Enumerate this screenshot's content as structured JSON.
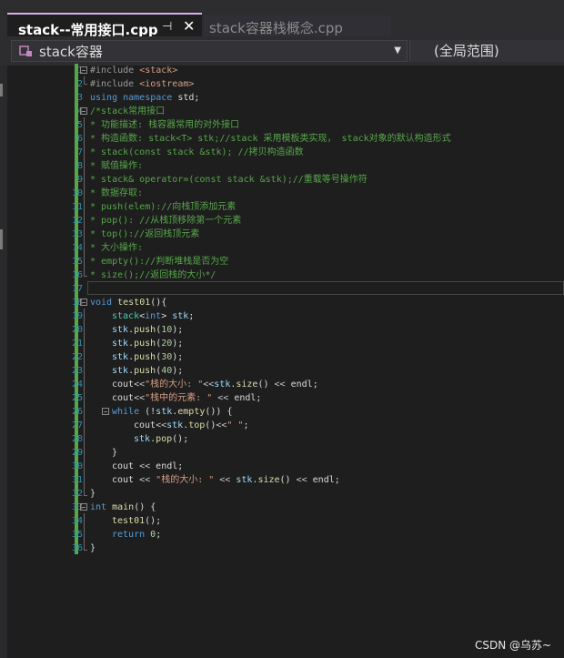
{
  "tabs": {
    "active": {
      "title": "stack--常用接口.cpp",
      "pin_glyph": "⊣",
      "close_glyph": "✕"
    },
    "inactive": {
      "title": "stack容器栈概念.cpp"
    }
  },
  "nav": {
    "scope_value": "stack容器",
    "global_scope": "(全局范围)"
  },
  "editor": {
    "line_numbers": [
      "1",
      "2",
      "3",
      "4",
      "5",
      "6",
      "7",
      "8",
      "9",
      "10",
      "11",
      "12",
      "13",
      "14",
      "15",
      "16",
      "17",
      "18",
      "19",
      "20",
      "21",
      "22",
      "23",
      "24",
      "25",
      "26",
      "27",
      "28",
      "29",
      "30",
      "31",
      "32",
      "33",
      "34",
      "35",
      "36"
    ],
    "lines": {
      "l1": [
        "#include ",
        "<stack>"
      ],
      "l2": [
        "#include ",
        "<iostream>"
      ],
      "l3": [
        "using namespace ",
        "std;"
      ],
      "l4": "/*stack常用接口",
      "l5": "* 功能描述: 栈容器常用的对外接口",
      "l6": "* 构造函数: stack<T> stk;//stack 采用模板类实现， stack对象的默认构造形式",
      "l7": "* stack(const stack &stk); //拷贝构造函数",
      "l8": "* 赋值操作:",
      "l9": "* stack& operator=(const stack &stk);//重载等号操作符",
      "l10": "* 数据存取:",
      "l11": "* push(elem)://向栈顶添加元素",
      "l12": "* pop(): //从栈顶移除第一个元素",
      "l13": "* top()://返回栈顶元素",
      "l14": "* 大小操作:",
      "l15": "* empty()://判断堆栈是否为空",
      "l16": "* size();//返回栈的大小*/",
      "l18": [
        "void ",
        "test01",
        "(){"
      ],
      "l19": [
        "stack",
        "<",
        "int",
        "> ",
        "stk",
        ";"
      ],
      "l20": [
        "stk",
        ".",
        "push",
        "(",
        "10",
        ");"
      ],
      "l21": [
        "stk",
        ".",
        "push",
        "(",
        "20",
        ");"
      ],
      "l22": [
        "stk",
        ".",
        "push",
        "(",
        "30",
        ");"
      ],
      "l23": [
        "stk",
        ".",
        "push",
        "(",
        "40",
        ");"
      ],
      "l24": [
        "cout",
        "<<",
        "\"栈的大小: \"",
        "<<",
        "stk",
        ".",
        "size",
        "() ",
        "<< ",
        "endl",
        ";"
      ],
      "l25": [
        "cout",
        "<<",
        "\"栈中的元素: \" ",
        "<< ",
        "endl",
        ";"
      ],
      "l26": [
        "while ",
        "(!",
        "stk",
        ".",
        "empty",
        "()) {"
      ],
      "l27": [
        "cout",
        "<<",
        "stk",
        ".",
        "top",
        "()",
        "<<",
        "\" \"",
        ";"
      ],
      "l28": [
        "stk",
        ".",
        "pop",
        "();"
      ],
      "l29": "}",
      "l30": [
        "cout ",
        "<< ",
        "endl",
        ";"
      ],
      "l31": [
        "cout ",
        "<< ",
        "\"栈的大小: \" ",
        "<< ",
        "stk",
        ".",
        "size",
        "() ",
        "<< ",
        "endl",
        ";"
      ],
      "l32": "}",
      "l33": [
        "int ",
        "main",
        "() {"
      ],
      "l34": [
        "test01",
        "();"
      ],
      "l35": [
        "return ",
        "0",
        ";"
      ],
      "l36": "}"
    }
  },
  "watermark": "CSDN @乌苏~"
}
